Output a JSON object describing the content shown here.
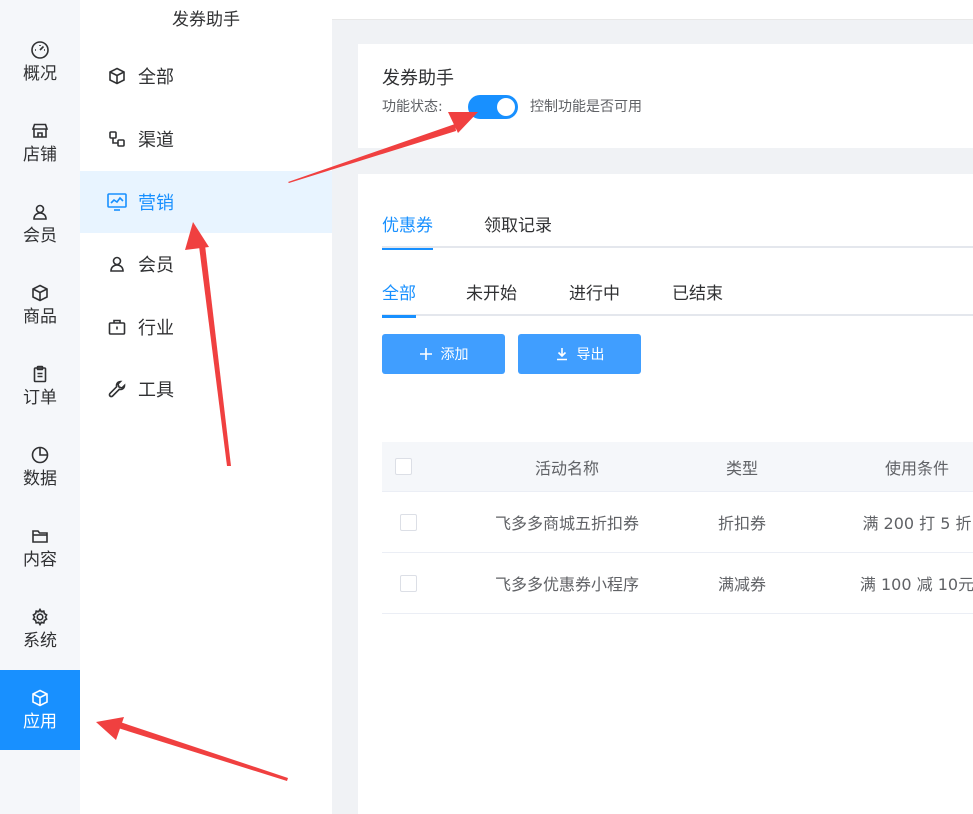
{
  "rail": {
    "items": [
      {
        "label": "概况",
        "icon": "dashboard-icon"
      },
      {
        "label": "店铺",
        "icon": "store-icon"
      },
      {
        "label": "会员",
        "icon": "user-icon"
      },
      {
        "label": "商品",
        "icon": "box-icon"
      },
      {
        "label": "订单",
        "icon": "clipboard-icon"
      },
      {
        "label": "数据",
        "icon": "pie-chart-icon"
      },
      {
        "label": "内容",
        "icon": "folder-icon"
      },
      {
        "label": "系统",
        "icon": "gear-icon"
      },
      {
        "label": "应用",
        "icon": "cube-icon"
      }
    ],
    "active_index": 8
  },
  "submenu": {
    "title": "发券助手",
    "items": [
      {
        "label": "全部",
        "icon": "cube-icon"
      },
      {
        "label": "渠道",
        "icon": "channel-icon"
      },
      {
        "label": "营销",
        "icon": "monitor-chart-icon"
      },
      {
        "label": "会员",
        "icon": "user-icon"
      },
      {
        "label": "行业",
        "icon": "briefcase-icon"
      },
      {
        "label": "工具",
        "icon": "wrench-icon"
      }
    ],
    "active_index": 2
  },
  "header": {
    "title": "发券助手",
    "status_label": "功能状态:",
    "status_on": true,
    "status_desc": "控制功能是否可用"
  },
  "main": {
    "tabs": [
      {
        "label": "优惠券",
        "active": true
      },
      {
        "label": "领取记录",
        "active": false
      }
    ],
    "filters": [
      {
        "label": "全部",
        "active": true
      },
      {
        "label": "未开始",
        "active": false
      },
      {
        "label": "进行中",
        "active": false
      },
      {
        "label": "已结束",
        "active": false
      }
    ],
    "add_label": "添加",
    "export_label": "导出",
    "table": {
      "columns": [
        "活动名称",
        "类型",
        "使用条件"
      ],
      "rows": [
        {
          "name": "飞多多商城五折扣券",
          "type": "折扣券",
          "condition": "满 200 打 5 折"
        },
        {
          "name": "飞多多优惠券小程序",
          "type": "满减券",
          "condition": "满 100 减 10元"
        }
      ]
    }
  },
  "colors": {
    "accent": "#1890ff",
    "button": "#409eff",
    "annotation": "#f04040"
  }
}
